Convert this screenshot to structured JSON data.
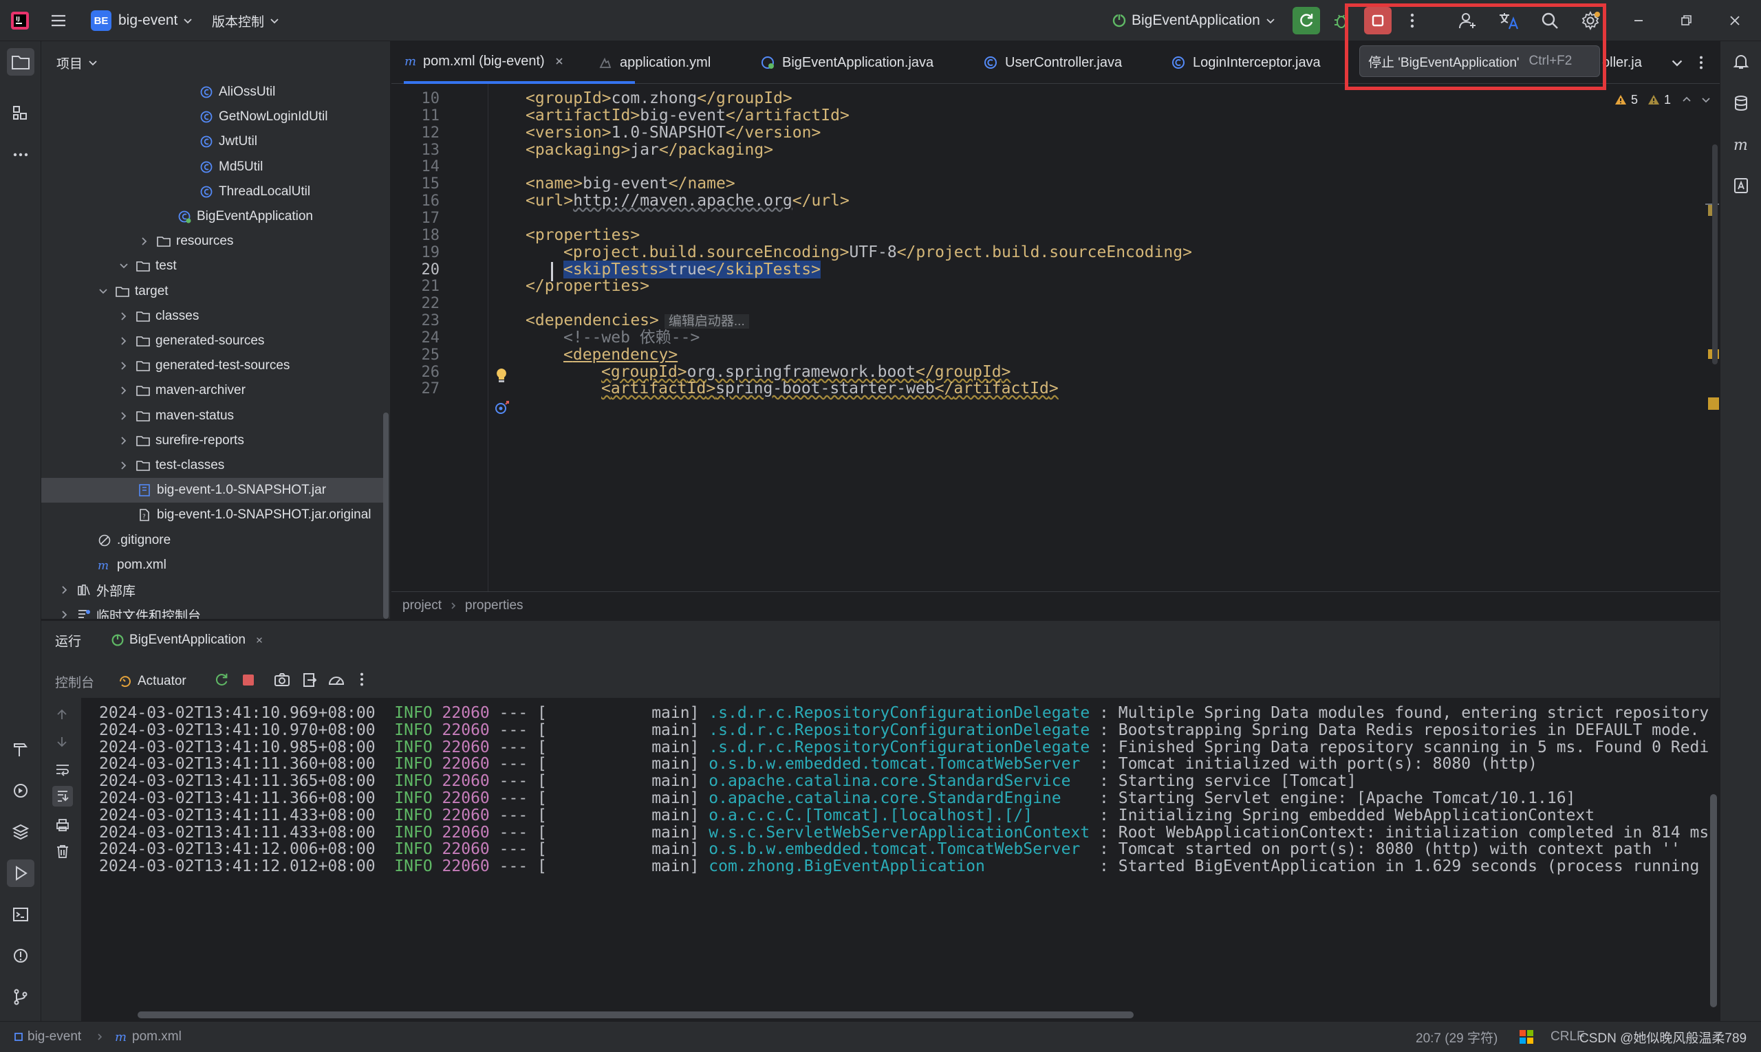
{
  "titlebar": {
    "project_badge": "BE",
    "project_name": "big-event",
    "vcs_menu": "版本控制",
    "run_config": "BigEventApplication",
    "tooltip_stop": "停止 'BigEventApplication'",
    "tooltip_shortcut": "Ctrl+F2"
  },
  "project_panel": {
    "title": "项目",
    "items": [
      {
        "label": "AliOssUtil",
        "icon": "class-icon"
      },
      {
        "label": "GetNowLoginIdUtil",
        "icon": "class-icon"
      },
      {
        "label": "JwtUtil",
        "icon": "class-icon"
      },
      {
        "label": "Md5Util",
        "icon": "class-icon"
      },
      {
        "label": "ThreadLocalUtil",
        "icon": "class-icon"
      },
      {
        "label": "BigEventApplication",
        "icon": "spring-class-icon"
      },
      {
        "label": "resources",
        "icon": "folder-icon"
      },
      {
        "label": "test",
        "icon": "folder-icon"
      },
      {
        "label": "target",
        "icon": "folder-icon"
      },
      {
        "label": "classes",
        "icon": "folder-icon"
      },
      {
        "label": "generated-sources",
        "icon": "folder-icon"
      },
      {
        "label": "generated-test-sources",
        "icon": "folder-icon"
      },
      {
        "label": "maven-archiver",
        "icon": "folder-icon"
      },
      {
        "label": "maven-status",
        "icon": "folder-icon"
      },
      {
        "label": "surefire-reports",
        "icon": "folder-icon"
      },
      {
        "label": "test-classes",
        "icon": "folder-icon"
      },
      {
        "label": "big-event-1.0-SNAPSHOT.jar",
        "icon": "jar-icon"
      },
      {
        "label": "big-event-1.0-SNAPSHOT.jar.original",
        "icon": "file-icon"
      },
      {
        "label": ".gitignore",
        "icon": "gitignore-icon"
      },
      {
        "label": "pom.xml",
        "icon": "maven-icon"
      },
      {
        "label": "外部库",
        "icon": "library-icon"
      },
      {
        "label": "临时文件和控制台",
        "icon": "scratch-icon"
      }
    ]
  },
  "tabs": [
    {
      "label": "pom.xml (big-event)",
      "active": true
    },
    {
      "label": "application.yml"
    },
    {
      "label": "BigEventApplication.java"
    },
    {
      "label": "UserController.java"
    },
    {
      "label": "LoginInterceptor.java"
    },
    {
      "label": "oller.ja"
    }
  ],
  "editor": {
    "warnings": "5",
    "weak_warnings": "1",
    "lines": [
      {
        "n": "10",
        "indent": 1,
        "open": "groupId",
        "text": "com.zhong",
        "close": "groupId"
      },
      {
        "n": "11",
        "indent": 1,
        "open": "artifactId",
        "text": "big-event",
        "close": "artifactId"
      },
      {
        "n": "12",
        "indent": 1,
        "open": "version",
        "text": "1.0-SNAPSHOT",
        "close": "version"
      },
      {
        "n": "13",
        "indent": 1,
        "open": "packaging",
        "text": "jar",
        "close": "packaging"
      },
      {
        "n": "14"
      },
      {
        "n": "15",
        "indent": 1,
        "open": "name",
        "text": "big-event",
        "close": "name"
      },
      {
        "n": "16",
        "indent": 1,
        "open": "url",
        "text": "http://maven.apache.org",
        "close": "url"
      },
      {
        "n": "17"
      },
      {
        "n": "18",
        "indent": 1,
        "open": "properties"
      },
      {
        "n": "19",
        "indent": 2,
        "open": "project.build.sourceEncoding",
        "text": "UTF-8",
        "close": "project.build.sourceEncoding"
      },
      {
        "n": "20",
        "indent": 2,
        "open": "skipTests",
        "text": "true",
        "close": "skipTests",
        "selected": true
      },
      {
        "n": "21",
        "indent": 1,
        "close_only": "properties"
      },
      {
        "n": "22"
      },
      {
        "n": "23",
        "indent": 1,
        "open": "dependencies",
        "hint": "编辑启动器..."
      },
      {
        "n": "24",
        "indent": 2,
        "comment": "<!--web 依赖-->"
      },
      {
        "n": "25",
        "indent": 2,
        "open": "dependency"
      },
      {
        "n": "26",
        "indent": 3,
        "open": "groupId",
        "text": "org.springframework.boot",
        "close": "groupId"
      },
      {
        "n": "27",
        "indent": 3,
        "open": "artifactId",
        "text": "spring-boot-starter-web",
        "close": "artifactId"
      }
    ]
  },
  "breadcrumb": [
    "project",
    "properties"
  ],
  "run": {
    "title": "运行",
    "tab": "BigEventApplication",
    "console_tab": "控制台",
    "actuator_tab": "Actuator",
    "logs": [
      {
        "ts": "2024-03-02T13:41:10.969+08:00",
        "level": "INFO",
        "pid": "22060",
        "thread": "main",
        "logger": ".s.d.r.c.RepositoryConfigurationDelegate",
        "msg": ": Multiple Spring Data modules found, entering strict repository"
      },
      {
        "ts": "2024-03-02T13:41:10.970+08:00",
        "level": "INFO",
        "pid": "22060",
        "thread": "main",
        "logger": ".s.d.r.c.RepositoryConfigurationDelegate",
        "msg": ": Bootstrapping Spring Data Redis repositories in DEFAULT mode."
      },
      {
        "ts": "2024-03-02T13:41:10.985+08:00",
        "level": "INFO",
        "pid": "22060",
        "thread": "main",
        "logger": ".s.d.r.c.RepositoryConfigurationDelegate",
        "msg": ": Finished Spring Data repository scanning in 5 ms. Found 0 Redi"
      },
      {
        "ts": "2024-03-02T13:41:11.360+08:00",
        "level": "INFO",
        "pid": "22060",
        "thread": "main",
        "logger": "o.s.b.w.embedded.tomcat.TomcatWebServer",
        "msg": ": Tomcat initialized with port(s): 8080 (http)"
      },
      {
        "ts": "2024-03-02T13:41:11.365+08:00",
        "level": "INFO",
        "pid": "22060",
        "thread": "main",
        "logger": "o.apache.catalina.core.StandardService",
        "msg": ": Starting service [Tomcat]"
      },
      {
        "ts": "2024-03-02T13:41:11.366+08:00",
        "level": "INFO",
        "pid": "22060",
        "thread": "main",
        "logger": "o.apache.catalina.core.StandardEngine",
        "msg": ": Starting Servlet engine: [Apache Tomcat/10.1.16]"
      },
      {
        "ts": "2024-03-02T13:41:11.433+08:00",
        "level": "INFO",
        "pid": "22060",
        "thread": "main",
        "logger": "o.a.c.c.C.[Tomcat].[localhost].[/]",
        "msg": ": Initializing Spring embedded WebApplicationContext"
      },
      {
        "ts": "2024-03-02T13:41:11.433+08:00",
        "level": "INFO",
        "pid": "22060",
        "thread": "main",
        "logger": "w.s.c.ServletWebServerApplicationContext",
        "msg": ": Root WebApplicationContext: initialization completed in 814 ms"
      },
      {
        "ts": "2024-03-02T13:41:12.006+08:00",
        "level": "INFO",
        "pid": "22060",
        "thread": "main",
        "logger": "o.s.b.w.embedded.tomcat.TomcatWebServer",
        "msg": ": Tomcat started on port(s): 8080 (http) with context path ''"
      },
      {
        "ts": "2024-03-02T13:41:12.012+08:00",
        "level": "INFO",
        "pid": "22060",
        "thread": "main",
        "logger": "com.zhong.BigEventApplication",
        "msg": ": Started BigEventApplication in 1.629 seconds (process running"
      }
    ]
  },
  "statusbar": {
    "project": "big-event",
    "file": "pom.xml",
    "position": "20:7 (29 字符)",
    "line_sep": "CRLF",
    "watermark": "CSDN @她似晚风般温柔789"
  },
  "colors": {
    "accent": "#3574f0",
    "highlight_box": "#e5383b",
    "stop": "#db5c5c",
    "rerun": "#5fb865"
  }
}
